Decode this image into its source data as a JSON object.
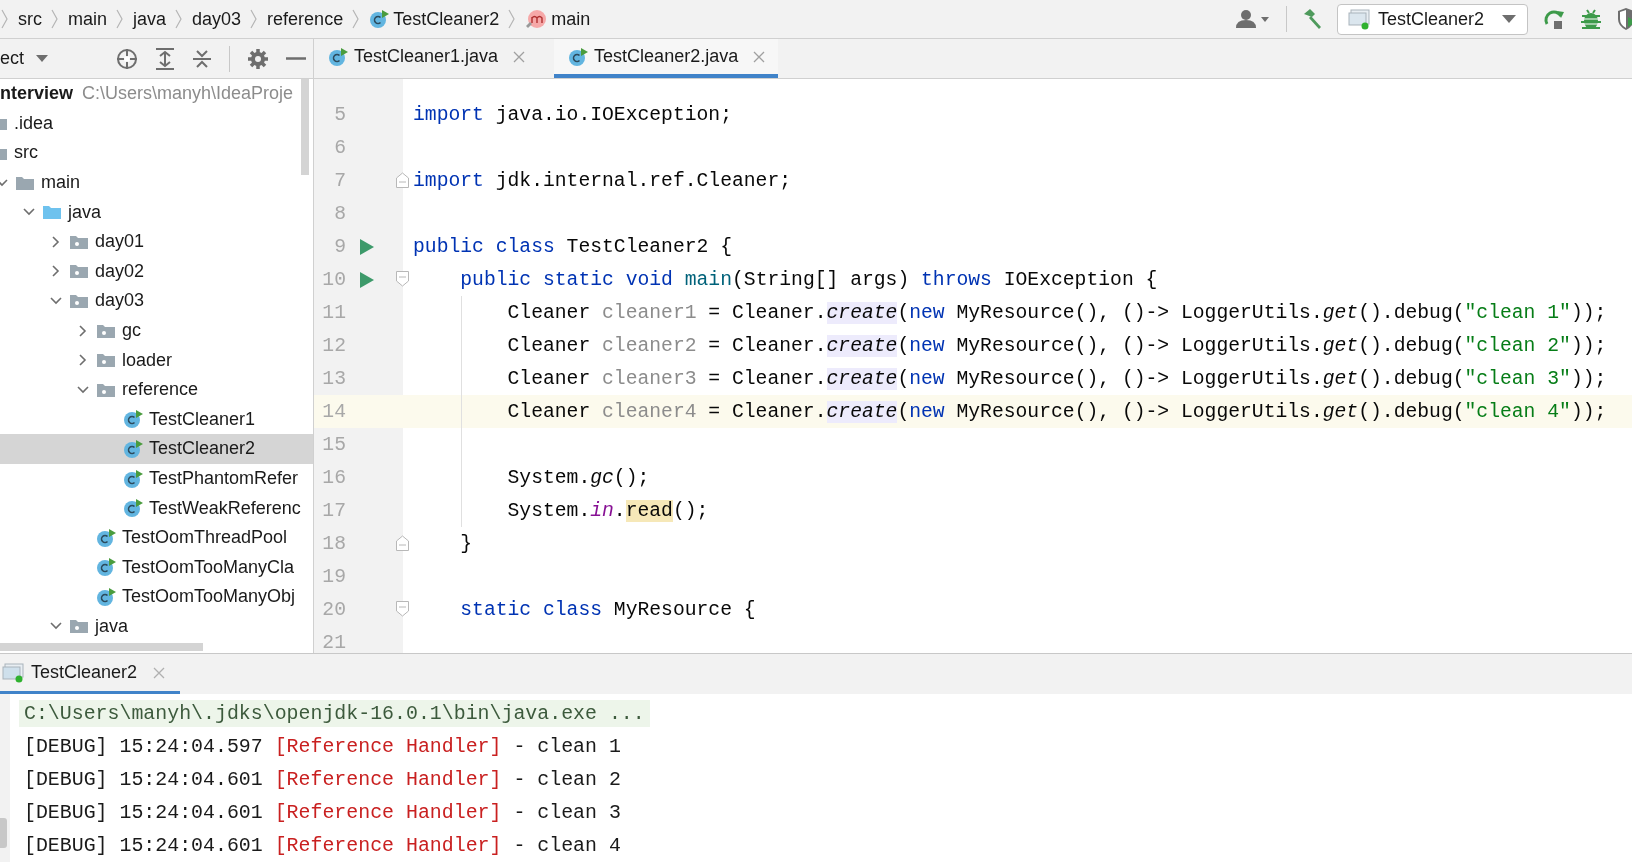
{
  "breadcrumbs": [
    {
      "label": "src",
      "kind": "plain"
    },
    {
      "label": "main",
      "kind": "plain"
    },
    {
      "label": "java",
      "kind": "plain"
    },
    {
      "label": "day03",
      "kind": "plain"
    },
    {
      "label": "reference",
      "kind": "plain"
    },
    {
      "label": "TestCleaner2",
      "kind": "class"
    },
    {
      "label": "main",
      "kind": "method"
    }
  ],
  "toolbar": {
    "run_config": "TestCleaner2"
  },
  "project_panel": {
    "title": "ect",
    "tree": [
      {
        "label": "nterview",
        "path": "C:\\Users\\manyh\\IdeaProje",
        "kind": "project",
        "selected": false,
        "children": [
          {
            "label": ".idea",
            "kind": "folder",
            "selected": false
          },
          {
            "label": "src",
            "kind": "folder",
            "selected": false,
            "children": [
              {
                "label": "main",
                "kind": "folder",
                "expanded": true,
                "selected": false,
                "children": [
                  {
                    "label": "java",
                    "kind": "source-folder",
                    "expanded": true,
                    "selected": false,
                    "children": [
                      {
                        "label": "day01",
                        "kind": "package",
                        "expanded": false,
                        "selected": false
                      },
                      {
                        "label": "day02",
                        "kind": "package",
                        "expanded": false,
                        "selected": false
                      },
                      {
                        "label": "day03",
                        "kind": "package",
                        "expanded": true,
                        "selected": false,
                        "children": [
                          {
                            "label": "gc",
                            "kind": "package",
                            "expanded": false,
                            "selected": false
                          },
                          {
                            "label": "loader",
                            "kind": "package",
                            "expanded": false,
                            "selected": false
                          },
                          {
                            "label": "reference",
                            "kind": "package",
                            "expanded": true,
                            "selected": false,
                            "children": [
                              {
                                "label": "TestCleaner1",
                                "kind": "class",
                                "selected": false
                              },
                              {
                                "label": "TestCleaner2",
                                "kind": "class",
                                "selected": true
                              },
                              {
                                "label": "TestPhantomRefer",
                                "kind": "class",
                                "selected": false
                              },
                              {
                                "label": "TestWeakReferenc",
                                "kind": "class",
                                "selected": false
                              }
                            ]
                          },
                          {
                            "label": "TestOomThreadPool",
                            "kind": "class",
                            "selected": false
                          },
                          {
                            "label": "TestOomTooManyCla",
                            "kind": "class",
                            "selected": false
                          },
                          {
                            "label": "TestOomTooManyObj",
                            "kind": "class",
                            "selected": false
                          }
                        ]
                      },
                      {
                        "label": "java",
                        "kind": "package",
                        "expanded": true,
                        "selected": false
                      }
                    ]
                  }
                ]
              }
            ]
          }
        ]
      }
    ]
  },
  "editor_tabs": [
    {
      "label": "TestCleaner1.java",
      "selected": false
    },
    {
      "label": "TestCleaner2.java",
      "selected": true
    }
  ],
  "code_lines": [
    {
      "number": "5",
      "current": false,
      "tokens": [
        {
          "text": "import",
          "kind": "keyword"
        },
        {
          "text": " java.io.IOException;",
          "kind": "plain"
        }
      ]
    },
    {
      "number": "6",
      "current": false
    },
    {
      "number": "7",
      "current": false,
      "fold_end": true,
      "tokens": [
        {
          "text": "import",
          "kind": "keyword"
        },
        {
          "text": " jdk.internal.ref.Cleaner;",
          "kind": "plain"
        }
      ]
    },
    {
      "number": "8",
      "current": false
    },
    {
      "number": "9",
      "current": false,
      "run": true,
      "tokens": [
        {
          "text": "public class",
          "kind": "keyword"
        },
        {
          "text": " TestCleaner2 {",
          "kind": "plain"
        }
      ]
    },
    {
      "number": "10",
      "current": false,
      "run": true,
      "fold_start": true,
      "tokens": [
        {
          "text": "    public static void ",
          "kind": "keyword"
        },
        {
          "text": "main",
          "kind": "declaration"
        },
        {
          "text": "(String[] args) ",
          "kind": "plain"
        },
        {
          "text": "throws",
          "kind": "keyword"
        },
        {
          "text": " IOException {",
          "kind": "plain"
        }
      ]
    },
    {
      "number": "11",
      "current": false,
      "tokens": [
        {
          "text": "        Cleaner ",
          "kind": "plain"
        },
        {
          "text": "cleaner1",
          "kind": "unused"
        },
        {
          "text": " = Cleaner.",
          "kind": "plain"
        },
        {
          "text": "create",
          "kind": "static-call",
          "usage_highlight": true
        },
        {
          "text": "(",
          "kind": "plain"
        },
        {
          "text": "new",
          "kind": "keyword"
        },
        {
          "text": " MyResource(), ()-> LoggerUtils.",
          "kind": "plain"
        },
        {
          "text": "get",
          "kind": "static-call"
        },
        {
          "text": "().debug(",
          "kind": "plain"
        },
        {
          "text": "\"clean 1\"",
          "kind": "string"
        },
        {
          "text": "));",
          "kind": "plain"
        }
      ]
    },
    {
      "number": "12",
      "current": false,
      "tokens": [
        {
          "text": "        Cleaner ",
          "kind": "plain"
        },
        {
          "text": "cleaner2",
          "kind": "unused"
        },
        {
          "text": " = Cleaner.",
          "kind": "plain"
        },
        {
          "text": "create",
          "kind": "static-call",
          "usage_highlight": true
        },
        {
          "text": "(",
          "kind": "plain"
        },
        {
          "text": "new",
          "kind": "keyword"
        },
        {
          "text": " MyResource(), ()-> LoggerUtils.",
          "kind": "plain"
        },
        {
          "text": "get",
          "kind": "static-call"
        },
        {
          "text": "().debug(",
          "kind": "plain"
        },
        {
          "text": "\"clean 2\"",
          "kind": "string"
        },
        {
          "text": "));",
          "kind": "plain"
        }
      ]
    },
    {
      "number": "13",
      "current": false,
      "tokens": [
        {
          "text": "        Cleaner ",
          "kind": "plain"
        },
        {
          "text": "cleaner3",
          "kind": "unused"
        },
        {
          "text": " = Cleaner.",
          "kind": "plain"
        },
        {
          "text": "create",
          "kind": "static-call",
          "usage_highlight": true
        },
        {
          "text": "(",
          "kind": "plain"
        },
        {
          "text": "new",
          "kind": "keyword"
        },
        {
          "text": " MyResource(), ()-> LoggerUtils.",
          "kind": "plain"
        },
        {
          "text": "get",
          "kind": "static-call"
        },
        {
          "text": "().debug(",
          "kind": "plain"
        },
        {
          "text": "\"clean 3\"",
          "kind": "string"
        },
        {
          "text": "));",
          "kind": "plain"
        }
      ]
    },
    {
      "number": "14",
      "current": true,
      "tokens": [
        {
          "text": "        Cleaner ",
          "kind": "plain"
        },
        {
          "text": "cleaner4",
          "kind": "unused"
        },
        {
          "text": " = Cleaner.",
          "kind": "plain"
        },
        {
          "text": "create",
          "kind": "static-call",
          "usage_highlight": true
        },
        {
          "text": "(",
          "kind": "plain"
        },
        {
          "text": "new",
          "kind": "keyword"
        },
        {
          "text": " MyResource(), ()-> LoggerUtils.",
          "kind": "plain"
        },
        {
          "text": "get",
          "kind": "static-call"
        },
        {
          "text": "().debug(",
          "kind": "plain"
        },
        {
          "text": "\"clean 4\"",
          "kind": "string"
        },
        {
          "text": "));",
          "kind": "plain"
        }
      ]
    },
    {
      "number": "15",
      "current": false
    },
    {
      "number": "16",
      "current": false,
      "tokens": [
        {
          "text": "        System.",
          "kind": "plain"
        },
        {
          "text": "gc",
          "kind": "static-call"
        },
        {
          "text": "();",
          "kind": "plain"
        }
      ]
    },
    {
      "number": "17",
      "current": false,
      "tokens": [
        {
          "text": "        System.",
          "kind": "plain"
        },
        {
          "text": "in",
          "kind": "static-field"
        },
        {
          "text": ".",
          "kind": "plain"
        },
        {
          "text": "read",
          "kind": "plain",
          "caret_highlight": true
        },
        {
          "text": "();",
          "kind": "plain"
        }
      ]
    },
    {
      "number": "18",
      "current": false,
      "fold_end": true,
      "tokens": [
        {
          "text": "    }",
          "kind": "plain"
        }
      ]
    },
    {
      "number": "19",
      "current": false
    },
    {
      "number": "20",
      "current": false,
      "fold_start": true,
      "tokens": [
        {
          "text": "    static class",
          "kind": "keyword"
        },
        {
          "text": " MyResource {",
          "kind": "plain"
        }
      ]
    },
    {
      "number": "21",
      "current": false
    }
  ],
  "console": {
    "tab": "TestCleaner2",
    "lines": [
      {
        "kind": "command",
        "segments": [
          {
            "text": "C:\\Users\\manyh\\.jdks\\openjdk-16.0.1\\bin\\java.exe ...",
            "kind": "plain"
          }
        ]
      },
      {
        "kind": "output",
        "segments": [
          {
            "text": "[DEBUG] 15:24:04.597 ",
            "kind": "plain"
          },
          {
            "text": "[Reference Handler]",
            "kind": "thread"
          },
          {
            "text": " - clean 1",
            "kind": "plain"
          }
        ]
      },
      {
        "kind": "output",
        "segments": [
          {
            "text": "[DEBUG] 15:24:04.601 ",
            "kind": "plain"
          },
          {
            "text": "[Reference Handler]",
            "kind": "thread"
          },
          {
            "text": " - clean 2",
            "kind": "plain"
          }
        ]
      },
      {
        "kind": "output",
        "segments": [
          {
            "text": "[DEBUG] 15:24:04.601 ",
            "kind": "plain"
          },
          {
            "text": "[Reference Handler]",
            "kind": "thread"
          },
          {
            "text": " - clean 3",
            "kind": "plain"
          }
        ]
      },
      {
        "kind": "output",
        "segments": [
          {
            "text": "[DEBUG] 15:24:04.601 ",
            "kind": "plain"
          },
          {
            "text": "[Reference Handler]",
            "kind": "thread"
          },
          {
            "text": " - clean 4",
            "kind": "plain"
          }
        ]
      }
    ]
  }
}
